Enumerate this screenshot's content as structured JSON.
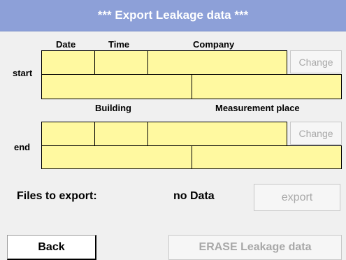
{
  "title": "***   Export Leakage data   ***",
  "headers": {
    "date": "Date",
    "time": "Time",
    "company": "Company",
    "building": "Building",
    "measurement_place": "Measurement place"
  },
  "start": {
    "label": "start",
    "change_label": "Change",
    "date": "",
    "time": "",
    "company": "",
    "building": "",
    "measurement_place": ""
  },
  "end": {
    "label": "end",
    "change_label": "Change",
    "date": "",
    "time": "",
    "company": "",
    "building": "",
    "measurement_place": ""
  },
  "files": {
    "label": "Files to export:",
    "value": "no Data"
  },
  "buttons": {
    "export": "export",
    "back": "Back",
    "erase": "ERASE Leakage data"
  },
  "colors": {
    "titlebar": "#8da0d8",
    "field_fill": "#fff9a0",
    "disabled_text": "#a8a8a8"
  }
}
